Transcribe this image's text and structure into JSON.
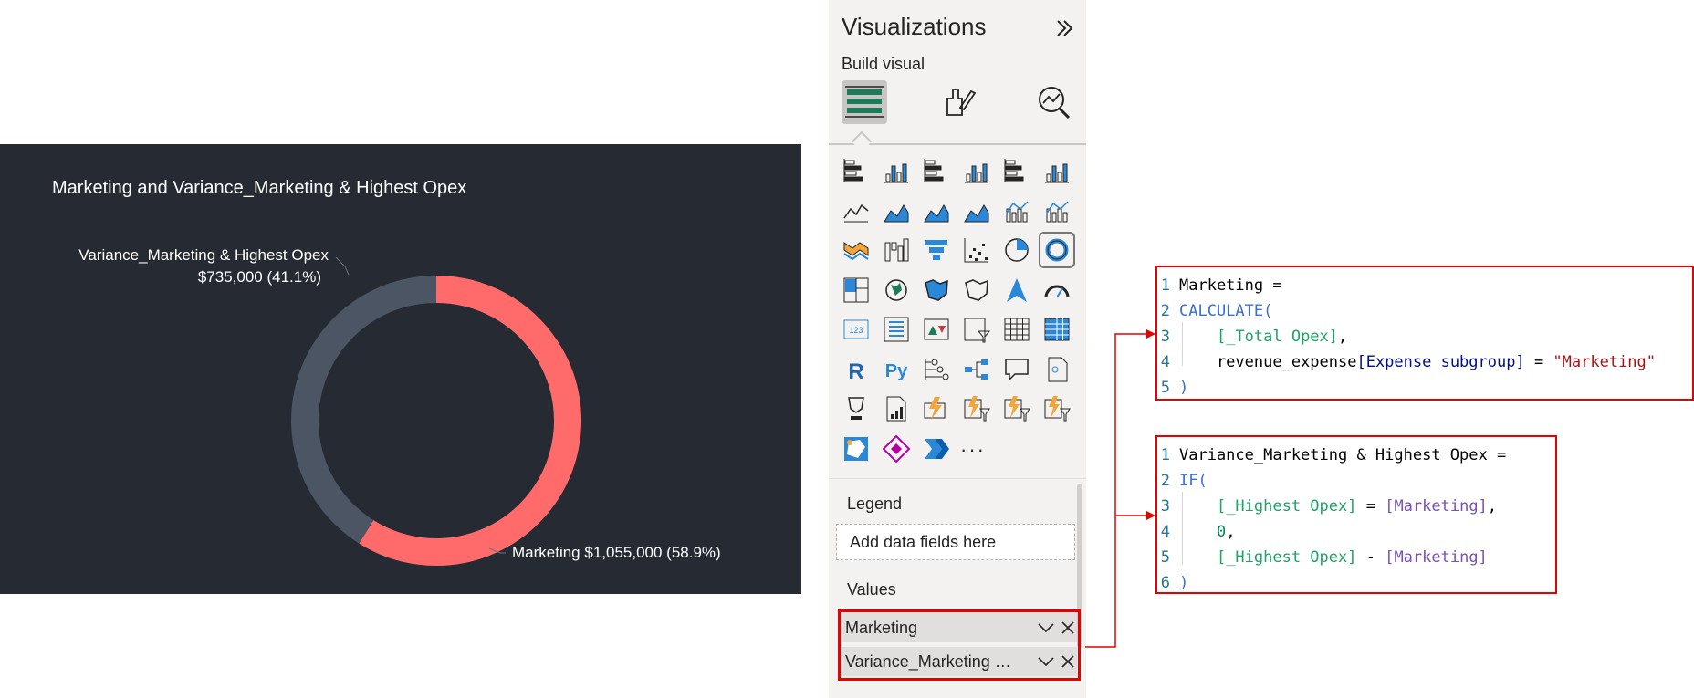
{
  "chart": {
    "title": "Marketing and Variance_Marketing & Highest Opex",
    "colors": {
      "background": "#252a33",
      "Marketing": "#ff6b6b",
      "Variance_Marketing & Highest Opex": "#4b5563"
    },
    "labels": {
      "variance_name": "Variance_Marketing & Highest Opex",
      "variance_value": "$735,000 (41.1%)",
      "marketing": "Marketing $1,055,000 (58.9%)"
    }
  },
  "chart_data": {
    "type": "pie",
    "variant": "donut",
    "title": "Marketing and Variance_Marketing & Highest Opex",
    "categories": [
      "Marketing",
      "Variance_Marketing & Highest Opex"
    ],
    "values": [
      1055000,
      735000
    ],
    "percentages": [
      58.9,
      41.1
    ],
    "legend": "none (detail labels)"
  },
  "visualizations": {
    "title": "Visualizations",
    "build_label": "Build visual",
    "modes": [
      "build-visual-icon",
      "format-visual-icon",
      "analytics-icon"
    ],
    "selected_visual": "donut-chart",
    "more": "···",
    "legend_label": "Legend",
    "legend_placeholder": "Add data fields here",
    "values_label": "Values",
    "value_fields": [
      "Marketing",
      "Variance_Marketing &..."
    ]
  },
  "code": {
    "block1": [
      {
        "n": "1",
        "parts": [
          [
            "plain",
            "Marketing ="
          ]
        ]
      },
      {
        "n": "2",
        "parts": [
          [
            "func",
            "CALCULATE("
          ]
        ]
      },
      {
        "n": "3",
        "parts": [
          [
            "plain",
            "    "
          ],
          [
            "measure",
            "[_Total Opex]"
          ],
          [
            "plain",
            ","
          ]
        ]
      },
      {
        "n": "4",
        "parts": [
          [
            "plain",
            "    revenue_expense"
          ],
          [
            "col",
            "[Expense subgroup]"
          ],
          [
            "plain",
            " = "
          ],
          [
            "str",
            "\"Marketing\""
          ]
        ]
      },
      {
        "n": "5",
        "parts": [
          [
            "func",
            ")"
          ]
        ]
      }
    ],
    "block2": [
      {
        "n": "1",
        "parts": [
          [
            "plain",
            "Variance_Marketing & Highest Opex ="
          ]
        ]
      },
      {
        "n": "2",
        "parts": [
          [
            "func",
            "IF("
          ]
        ]
      },
      {
        "n": "3",
        "parts": [
          [
            "plain",
            "    "
          ],
          [
            "measure",
            "[_Highest Opex]"
          ],
          [
            "plain",
            " = "
          ],
          [
            "meas2",
            "[Marketing]"
          ],
          [
            "plain",
            ","
          ]
        ]
      },
      {
        "n": "4",
        "parts": [
          [
            "plain",
            "    "
          ],
          [
            "num",
            "0"
          ],
          [
            "plain",
            ","
          ]
        ]
      },
      {
        "n": "5",
        "parts": [
          [
            "plain",
            "    "
          ],
          [
            "measure",
            "[_Highest Opex]"
          ],
          [
            "plain",
            " - "
          ],
          [
            "meas2",
            "[Marketing]"
          ]
        ]
      },
      {
        "n": "6",
        "parts": [
          [
            "func",
            ")"
          ]
        ]
      }
    ]
  }
}
